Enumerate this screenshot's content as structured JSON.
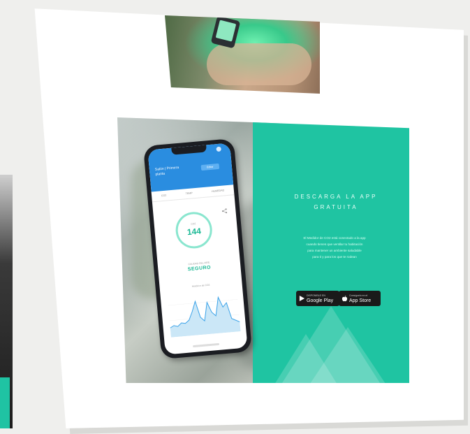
{
  "banner": {
    "headline": [
      "DESCARGA LA APP",
      "GRATUITA"
    ],
    "body": [
      "El Medidor de CO2 está conectado a la app",
      "cuando tienes que ventilar tu habitación",
      "para mantener un ambiente saludable",
      "para ti y para los que te rodean"
    ],
    "accent_color": "#1fc4a2",
    "stores": {
      "google": {
        "small": "DISPONIBLE EN",
        "big": "Google Play",
        "icon": "google-play-icon"
      },
      "apple": {
        "small": "Consíguelo en el",
        "big": "App Store",
        "icon": "apple-icon"
      }
    }
  },
  "phone": {
    "app_title": [
      "Salón | Primera",
      "planta"
    ],
    "app_action": "Editar",
    "tabs": [
      "CO2",
      "TEMP",
      "HUMEDAD"
    ],
    "gauge_label": "CO2",
    "gauge_value": "144",
    "status_caption": "CALIDAD DEL AIRE",
    "status_value": "SEGURO",
    "chart_title": "Histórico de CO2",
    "header_color": "#2a8de0",
    "value_color": "#19b894",
    "chart_values": [
      0.2,
      0.25,
      0.22,
      0.3,
      0.28,
      0.35,
      0.55,
      0.8,
      0.4,
      0.3,
      0.75,
      0.5,
      0.4,
      0.85,
      0.6,
      0.7,
      0.3,
      0.25,
      0.2
    ]
  }
}
